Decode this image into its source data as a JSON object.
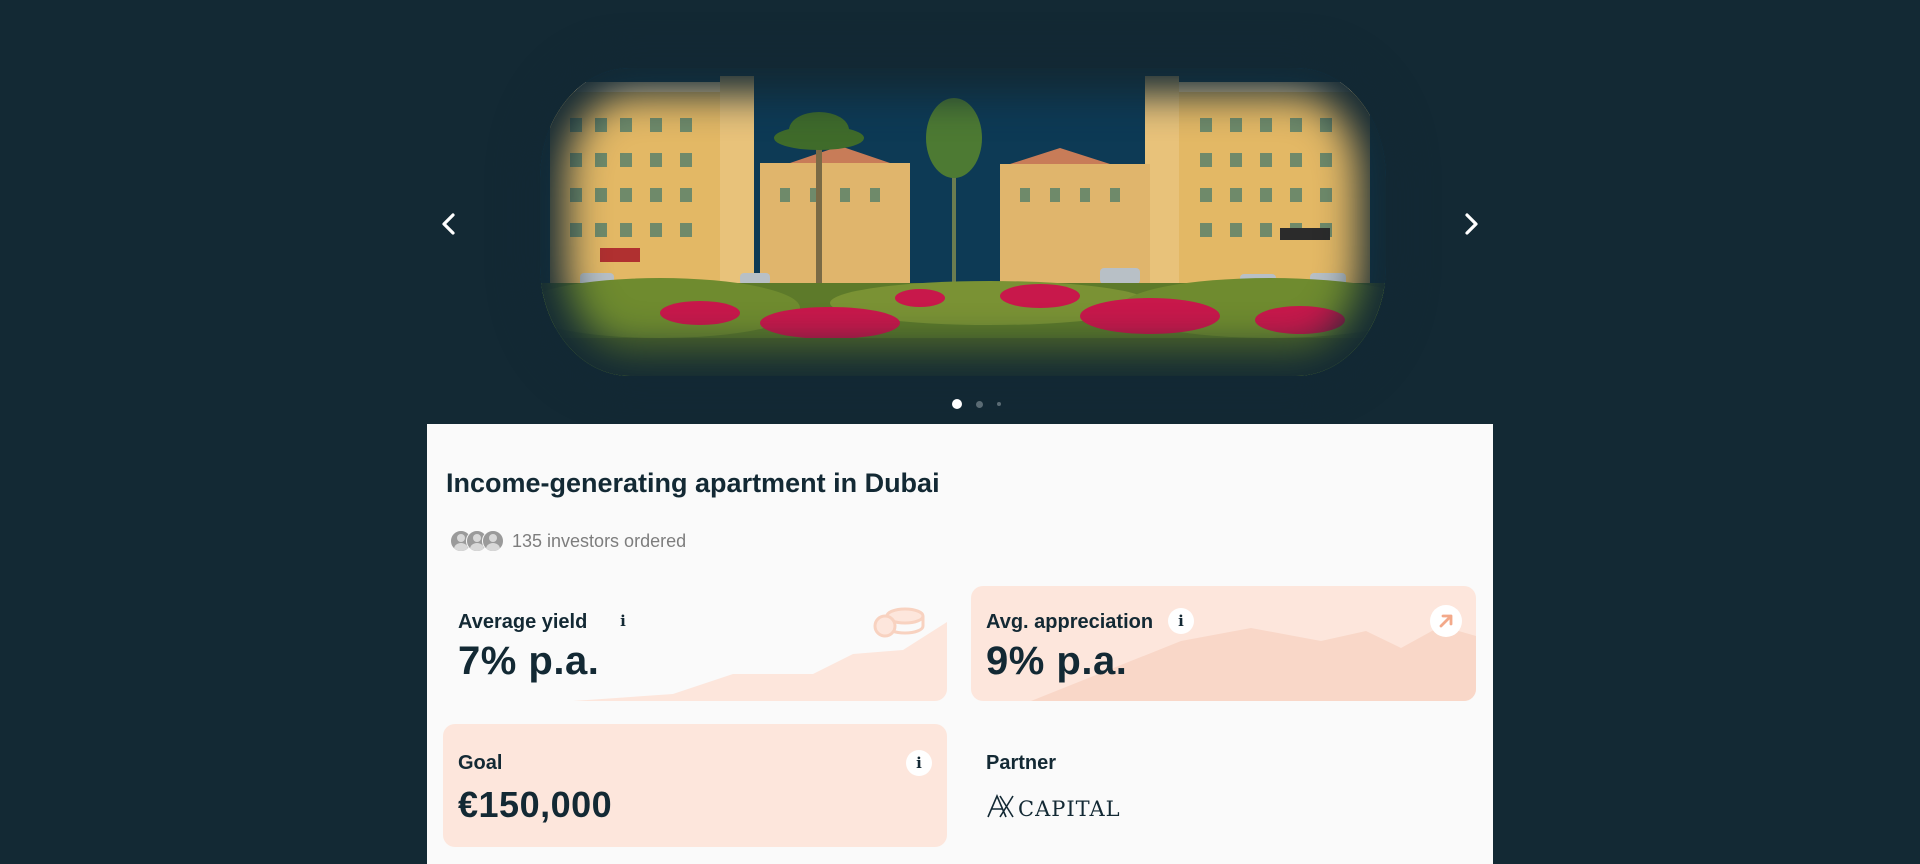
{
  "carousel": {
    "prev_icon": "chevron-left-icon",
    "next_icon": "chevron-right-icon",
    "slide_count": 3,
    "active_slide": 1
  },
  "listing": {
    "title": "Income-generating apartment in Dubai",
    "investors_text": "135 investors ordered"
  },
  "metrics": {
    "yield": {
      "label": "Average yield",
      "value": "7% p.a.",
      "icon": "coins-icon"
    },
    "appreciation": {
      "label": "Avg. appreciation",
      "value": "9% p.a.",
      "icon": "arrow-up-right-icon"
    },
    "goal": {
      "label": "Goal",
      "value": "€150,000"
    },
    "partner": {
      "label": "Partner",
      "logo_text": "AX CAPITAL"
    }
  },
  "colors": {
    "background": "#132934",
    "card": "#fafafa",
    "accent_tile": "#fde6dc",
    "accent_orange": "#f3a98a",
    "text_dark": "#132934"
  }
}
